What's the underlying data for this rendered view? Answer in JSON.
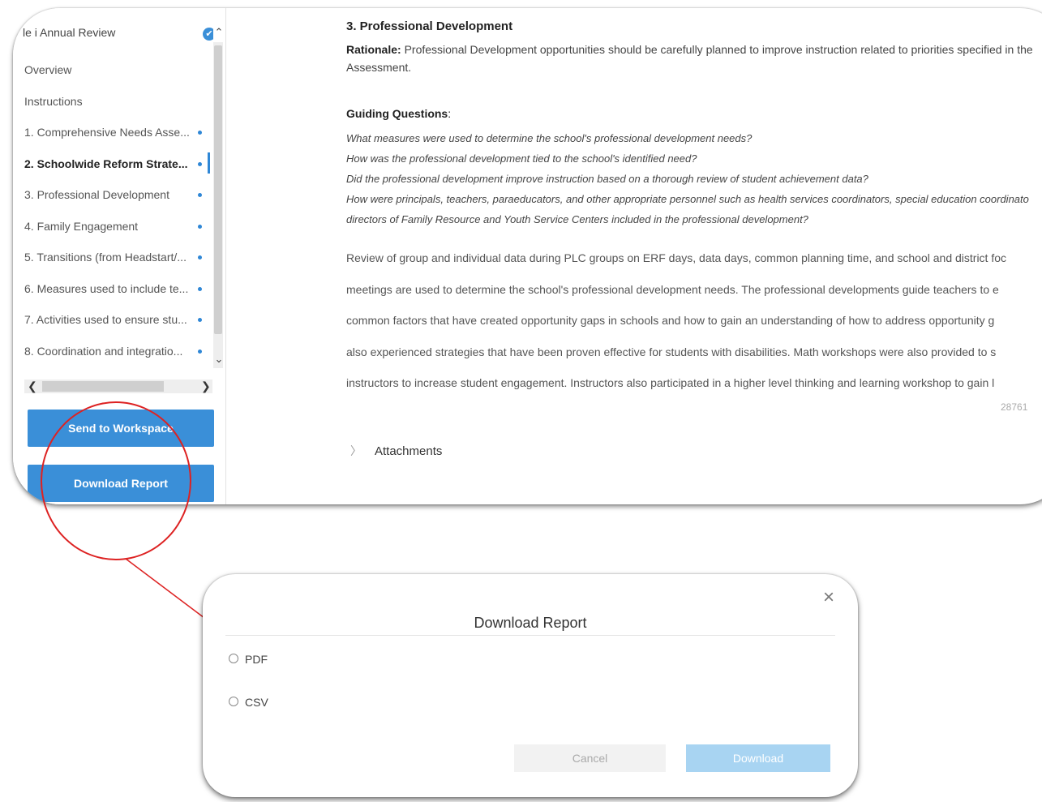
{
  "sidebar": {
    "header": "le i Annual Review",
    "items": [
      {
        "label": "Overview",
        "dot": false
      },
      {
        "label": "Instructions",
        "dot": false
      },
      {
        "label": "1. Comprehensive Needs Asse...",
        "dot": true
      },
      {
        "label": "2. Schoolwide Reform Strate...",
        "dot": true,
        "active": true
      },
      {
        "label": "3. Professional Development",
        "dot": true
      },
      {
        "label": "4. Family Engagement",
        "dot": true
      },
      {
        "label": "5. Transitions (from Headstart/...",
        "dot": true
      },
      {
        "label": "6. Measures used to include te...",
        "dot": true
      },
      {
        "label": "7. Activities used to ensure stu...",
        "dot": true
      },
      {
        "label": "8. Coordination and integratio...",
        "dot": true
      }
    ],
    "send_button": "Send to Workspace",
    "download_button": "Download Report"
  },
  "main": {
    "section_title": "3. Professional Development",
    "rationale_label": "Rationale:",
    "rationale_text": " Professional Development opportunities should be carefully planned to improve instruction related to priorities specified in the",
    "rationale_line2": "Assessment.",
    "guiding_title": "Guiding Questions",
    "guiding_colon": ":",
    "questions": [
      "What measures were used to determine the school's professional development needs?",
      "How was the professional development tied to the school's identified need?",
      "Did the professional development improve instruction based on a thorough review of student achievement data?",
      "How were principals, teachers, paraeducators, and other appropriate personnel such as health services coordinators, special education coordinato",
      "directors of Family Resource and Youth Service Centers included in the professional development?"
    ],
    "body_lines": [
      "Review of group and individual data during PLC groups on ERF days, data days, common planning time, and school and district foc",
      "meetings are used to determine the school's professional development needs. The professional developments guide teachers to e",
      "common factors that have created opportunity gaps in schools and how to gain an understanding of how to address opportunity g",
      "also experienced strategies that have been proven effective for students with disabilities. Math workshops were also provided to s",
      "instructors to increase student engagement. Instructors also participated in a higher level thinking and learning workshop to gain l"
    ],
    "char_count": "28761",
    "attachments_label": "Attachments"
  },
  "dialog": {
    "title": "Download Report",
    "close": "×",
    "options": [
      "PDF",
      "CSV"
    ],
    "cancel": "Cancel",
    "download": "Download"
  },
  "icons": {
    "check": "✔",
    "up": "⌃",
    "down": "⌄",
    "left": "❮",
    "right": "❯",
    "chevron": "〉"
  },
  "colors": {
    "accent": "#3a8fd8",
    "callout": "#d22222"
  }
}
